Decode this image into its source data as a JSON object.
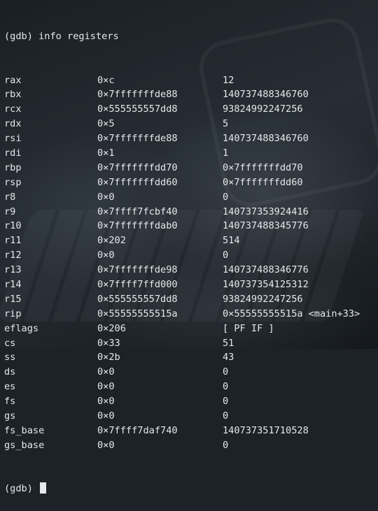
{
  "header": {
    "prompt": "(gdb)",
    "command": "info registers"
  },
  "registers": [
    {
      "name": "rax",
      "hex": "0×c",
      "value": "12",
      "annot": ""
    },
    {
      "name": "rbx",
      "hex": "0×7fffffffde88",
      "value": "140737488346760",
      "annot": ""
    },
    {
      "name": "rcx",
      "hex": "0×555555557dd8",
      "value": "93824992247256",
      "annot": ""
    },
    {
      "name": "rdx",
      "hex": "0×5",
      "value": "5",
      "annot": ""
    },
    {
      "name": "rsi",
      "hex": "0×7fffffffde88",
      "value": "140737488346760",
      "annot": ""
    },
    {
      "name": "rdi",
      "hex": "0×1",
      "value": "1",
      "annot": ""
    },
    {
      "name": "rbp",
      "hex": "0×7fffffffdd70",
      "value": "0×7fffffffdd70",
      "annot": ""
    },
    {
      "name": "rsp",
      "hex": "0×7fffffffdd60",
      "value": "0×7fffffffdd60",
      "annot": ""
    },
    {
      "name": "r8",
      "hex": "0×0",
      "value": "0",
      "annot": ""
    },
    {
      "name": "r9",
      "hex": "0×7ffff7fcbf40",
      "value": "140737353924416",
      "annot": ""
    },
    {
      "name": "r10",
      "hex": "0×7fffffffdab0",
      "value": "140737488345776",
      "annot": ""
    },
    {
      "name": "r11",
      "hex": "0×202",
      "value": "514",
      "annot": ""
    },
    {
      "name": "r12",
      "hex": "0×0",
      "value": "0",
      "annot": ""
    },
    {
      "name": "r13",
      "hex": "0×7fffffffde98",
      "value": "140737488346776",
      "annot": ""
    },
    {
      "name": "r14",
      "hex": "0×7ffff7ffd000",
      "value": "140737354125312",
      "annot": ""
    },
    {
      "name": "r15",
      "hex": "0×555555557dd8",
      "value": "93824992247256",
      "annot": ""
    },
    {
      "name": "rip",
      "hex": "0×55555555515a",
      "value": "0×55555555515a",
      "annot": "<main+33>"
    },
    {
      "name": "eflags",
      "hex": "0×206",
      "value": "[ PF IF ]",
      "annot": ""
    },
    {
      "name": "cs",
      "hex": "0×33",
      "value": "51",
      "annot": ""
    },
    {
      "name": "ss",
      "hex": "0×2b",
      "value": "43",
      "annot": ""
    },
    {
      "name": "ds",
      "hex": "0×0",
      "value": "0",
      "annot": ""
    },
    {
      "name": "es",
      "hex": "0×0",
      "value": "0",
      "annot": ""
    },
    {
      "name": "fs",
      "hex": "0×0",
      "value": "0",
      "annot": ""
    },
    {
      "name": "gs",
      "hex": "0×0",
      "value": "0",
      "annot": ""
    },
    {
      "name": "fs_base",
      "hex": "0×7ffff7daf740",
      "value": "140737351710528",
      "annot": ""
    },
    {
      "name": "gs_base",
      "hex": "0×0",
      "value": "0",
      "annot": ""
    }
  ],
  "footer": {
    "prompt": "(gdb)"
  },
  "colors": {
    "text": "#e6e8ea",
    "background": "#1c2228"
  }
}
